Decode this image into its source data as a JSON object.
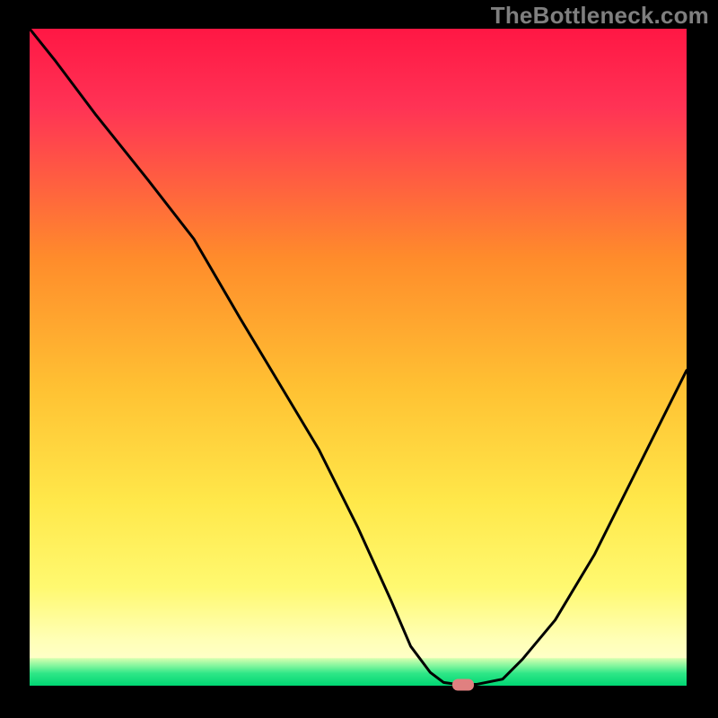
{
  "watermark": "TheBottleneck.com",
  "colors": {
    "black": "#000000",
    "red_top": "#ff1744",
    "orange_mid": "#ffb000",
    "yellow_low": "#ffee55",
    "pale_yellow": "#ffffb0",
    "green_band": "#00e676",
    "curve": "#000000",
    "marker": "#e08080"
  },
  "chart_data": {
    "type": "line",
    "title": "",
    "xlabel": "",
    "ylabel": "",
    "xlim": [
      0,
      100
    ],
    "ylim": [
      0,
      100
    ],
    "x": [
      0,
      4,
      10,
      18,
      25,
      32,
      38,
      44,
      50,
      55,
      58,
      61,
      63,
      65,
      68,
      72,
      75,
      80,
      86,
      92,
      96,
      100
    ],
    "values": [
      100,
      95,
      87,
      77,
      68,
      56,
      46,
      36,
      24,
      13,
      6,
      2,
      0.5,
      0.2,
      0.2,
      1,
      4,
      10,
      20,
      32,
      40,
      48
    ],
    "marker": {
      "x": 66,
      "y": 0.2
    },
    "band_top": 4.2,
    "band_bottom": 0
  }
}
